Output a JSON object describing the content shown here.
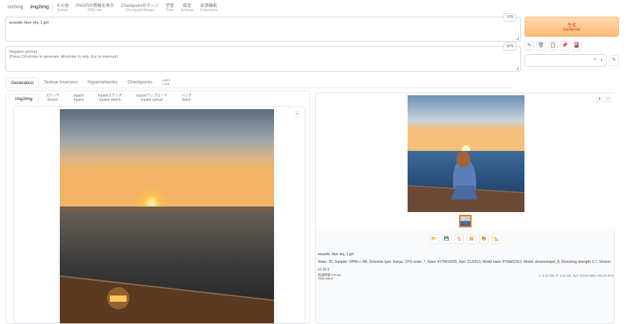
{
  "nav": {
    "tabs": [
      {
        "label": "txt2img",
        "en": ""
      },
      {
        "label": "img2img",
        "en": ""
      },
      {
        "label": "その他",
        "en": "Extras"
      },
      {
        "label": "PNG内の情報を表示",
        "en": "PNG Info"
      },
      {
        "label": "Checkpointのマージ",
        "en": "Checkpoint Merger"
      },
      {
        "label": "学習",
        "en": "Train"
      },
      {
        "label": "設定",
        "en": "Settings"
      },
      {
        "label": "拡張機能",
        "en": "Extensions"
      }
    ]
  },
  "prompt": {
    "value": "seaside, blue sky, 1 girl",
    "counter": "7/75"
  },
  "negative_prompt": {
    "placeholder": "Negative prompt\n(Press Ctrl+Enter to generate, Alt+Enter to skip, Esc to interrupt)",
    "counter": "0/75"
  },
  "generate": {
    "label_ja": "生成",
    "label_en": "Generate"
  },
  "tools": {
    "icons": [
      "paint-brush-icon",
      "trash-icon",
      "clipboard-icon",
      "pin-icon",
      "extra-networks-icon"
    ],
    "glyphs": [
      "✎",
      "🗑",
      "📋",
      "📌",
      "🎴"
    ]
  },
  "styles": {
    "clear": "×",
    "dropdown": "▾",
    "apply_glyph": "✎"
  },
  "extra_tabs": [
    {
      "label": "Generation"
    },
    {
      "label": "Textual Inversion"
    },
    {
      "label": "Hypernetworks"
    },
    {
      "label": "Checkpoints"
    },
    {
      "label": "LoRA\nLora"
    }
  ],
  "img2img_tabs": [
    {
      "label": "img2img",
      "en": ""
    },
    {
      "label": "スケッチ",
      "en": "Sketch"
    },
    {
      "label": "Inpaint",
      "en": "Inpaint"
    },
    {
      "label": "Inpaintスケッチ",
      "en": "Inpaint sketch"
    },
    {
      "label": "Inpaintアップロード",
      "en": "Inpaint upload"
    },
    {
      "label": "バッチ",
      "en": "Batch"
    }
  ],
  "canvas": {
    "close": "×"
  },
  "gallery": {
    "download": "⬇",
    "close": "×",
    "actions": [
      "📂",
      "💾",
      "🗜",
      "🖼",
      "🎨",
      "📐"
    ],
    "action_names": [
      "open-folder-icon",
      "save-icon",
      "zip-icon",
      "send-to-img2img-icon",
      "send-to-inpaint-icon",
      "send-to-extras-icon"
    ]
  },
  "info": {
    "prompt": "seaside, blue sky, 1 girl",
    "params": "Steps: 35, Sampler: DPM++ 2M, Schedule type: Karras, CFG scale: 7, Seed: 4170414203, Size: 512x512, Model hash: 879db523c3, Model: dreamshaper_8, Denoising strength: 0.7, Version: v1.10.1",
    "time_label": "経過時間",
    "time_value": "2.9 sec.",
    "time_sub": "Time taken",
    "memory": "A: 3.31 GB, R: 3.23 GB, Sys: 6.6/15.9961 GB (41.6%)"
  },
  "colors": {
    "accent": "#fdba74",
    "accent_text": "#c2410c",
    "border": "#e5e7eb"
  }
}
